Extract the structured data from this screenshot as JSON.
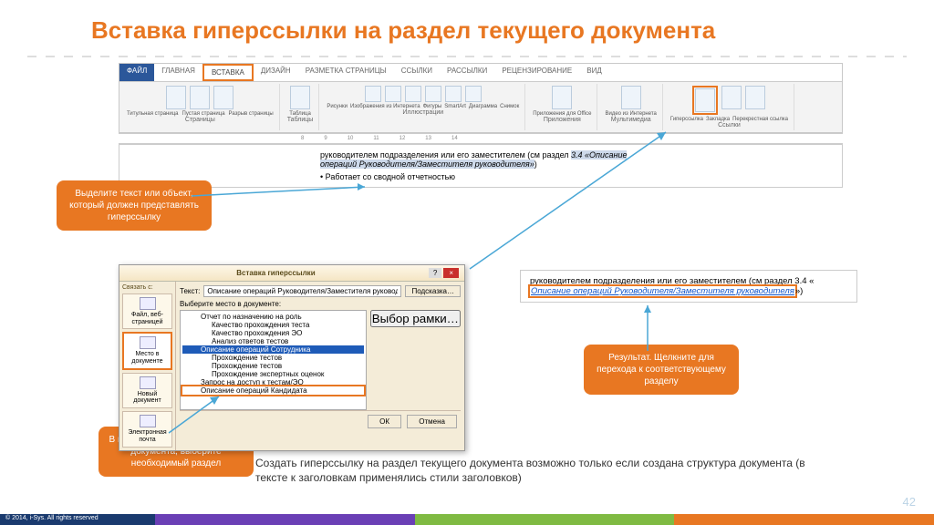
{
  "title": "Вставка гиперссылки на раздел текущего документа",
  "ribbon": {
    "tabs": [
      "ФАЙЛ",
      "ГЛАВНАЯ",
      "ВСТАВКА",
      "ДИЗАЙН",
      "РАЗМЕТКА СТРАНИЦЫ",
      "ССЫЛКИ",
      "РАССЫЛКИ",
      "РЕЦЕНЗИРОВАНИЕ",
      "ВИД"
    ],
    "active_tab": "ВСТАВКА",
    "groups": [
      {
        "label": "Страницы",
        "items": [
          "Титульная страница",
          "Пустая страница",
          "Разрыв страницы"
        ]
      },
      {
        "label": "Таблицы",
        "items": [
          "Таблица"
        ]
      },
      {
        "label": "Иллюстрации",
        "items": [
          "Рисунки",
          "Изображения из Интернета",
          "Фигуры",
          "SmartArt",
          "Диаграмма",
          "Снимок"
        ]
      },
      {
        "label": "Приложения",
        "items": [
          "Приложения для Office"
        ]
      },
      {
        "label": "Мультимедиа",
        "items": [
          "Видео из Интернета"
        ]
      },
      {
        "label": "Ссылки",
        "items": [
          "Гиперссылка",
          "Закладка",
          "Перекрестная ссылка"
        ],
        "highlight": "Гиперссылка"
      }
    ]
  },
  "ruler_marks": [
    "8",
    "9",
    "10",
    "11",
    "12",
    "13",
    "14"
  ],
  "doc_preview": {
    "line1_a": "руководителем подразделения или его заместителем (см раздел ",
    "line1_b": "3.4 «Описание",
    "line2": "операций Руководителя/Заместителя руководителя»",
    "line3": "Работает со сводной отчетностью"
  },
  "callouts": {
    "c1": "Выделите текст или объект, который должен представлять гиперссылку",
    "c2": "В поле отображается структура документа, выберите необходимый раздел",
    "c3": "Результат. Щелкните для перехода к соответствующему разделу"
  },
  "dialog": {
    "title": "Вставка гиперссылки",
    "link_to_label": "Связать с:",
    "text_label": "Текст:",
    "text_value": "Описание операций Руководителя/Заместителя руководителя",
    "hint_btn": "Подсказка…",
    "place_label": "Выберите место в документе:",
    "frame_btn": "Выбор рамки…",
    "side": [
      {
        "label": "Файл, веб-страницей"
      },
      {
        "label": "Место в документе",
        "selected": true
      },
      {
        "label": "Новый документ"
      },
      {
        "label": "Электронная почта"
      }
    ],
    "tree": [
      {
        "t": "Отчет по назначению на роль",
        "lvl": 2
      },
      {
        "t": "Качество прохождения теста",
        "lvl": 2
      },
      {
        "t": "Качество прохождения ЭО",
        "lvl": 2
      },
      {
        "t": "Анализ ответов тестов",
        "lvl": 2
      },
      {
        "t": "Описание операций Сотрудника",
        "lvl": 1,
        "sel": true
      },
      {
        "t": "Прохождение тестов",
        "lvl": 2
      },
      {
        "t": "Прохождение тестов",
        "lvl": 2
      },
      {
        "t": "Прохождение экспертных оценок",
        "lvl": 2
      },
      {
        "t": "Запрос на доступ к тестам/ЭО",
        "lvl": 1
      },
      {
        "t": "Описание операций Кандидата",
        "lvl": 1,
        "hl": true
      }
    ],
    "ok": "ОК",
    "cancel": "Отмена"
  },
  "result": {
    "line1_a": "руководителем подразделения или его заместителем (см раздел 3.4 «",
    "link": "Описание операций Руководителя/Заместителя руководителя",
    "line1_b": "»)"
  },
  "bottom_text": "Создать гиперссылку на раздел текущего документа возможно только если создана структура документа (в тексте к заголовкам применялись стили заголовков)",
  "page_number": "42",
  "footer": "© 2014, i-Sys. All rights reserved"
}
